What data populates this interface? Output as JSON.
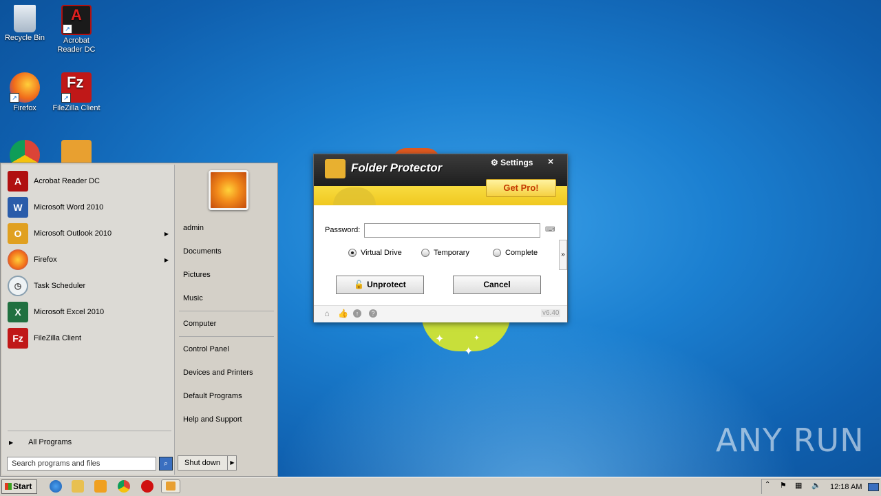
{
  "desktop": {
    "icons": [
      {
        "label": "Recycle Bin"
      },
      {
        "label": "Acrobat Reader DC"
      },
      {
        "label": "Firefox"
      },
      {
        "label": "FileZilla Client"
      }
    ],
    "watermark": "ANY RUN"
  },
  "start_menu": {
    "programs": [
      {
        "label": "Acrobat Reader DC",
        "icon": "acrobat-icon",
        "color": "#b01010"
      },
      {
        "label": "Microsoft Word 2010",
        "icon": "word-icon",
        "color": "#2a5caa"
      },
      {
        "label": "Microsoft Outlook 2010",
        "icon": "outlook-icon",
        "color": "#e0a020",
        "submenu": true
      },
      {
        "label": "Firefox",
        "icon": "firefox-icon",
        "color": "#e06020",
        "submenu": true
      },
      {
        "label": "Task Scheduler",
        "icon": "clock-icon",
        "color": "#8aa0b0"
      },
      {
        "label": "Microsoft Excel 2010",
        "icon": "excel-icon",
        "color": "#207040"
      },
      {
        "label": "FileZilla Client",
        "icon": "filezilla-icon",
        "color": "#c01818"
      }
    ],
    "all_programs": "All Programs",
    "search_placeholder": "Search programs and files",
    "right_items": [
      "admin",
      "Documents",
      "Pictures",
      "Music",
      "Computer",
      "Control Panel",
      "Devices and Printers",
      "Default Programs",
      "Help and Support"
    ],
    "shutdown": "Shut down"
  },
  "dialog": {
    "title": "Folder Protector",
    "settings": "Settings",
    "close": "×",
    "get_pro": "Get Pro!",
    "password_label": "Password:",
    "password_value": "",
    "options": [
      {
        "label": "Virtual Drive",
        "selected": true
      },
      {
        "label": "Temporary",
        "selected": false
      },
      {
        "label": "Complete",
        "selected": false
      }
    ],
    "expand": "»",
    "unprotect": "Unprotect",
    "cancel": "Cancel",
    "version": "v6.40"
  },
  "taskbar": {
    "start": "Start",
    "clock": "12:18 AM"
  }
}
